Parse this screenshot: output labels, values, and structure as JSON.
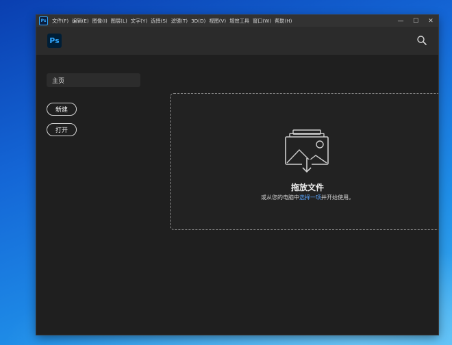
{
  "window": {
    "menu": [
      "文件(F)",
      "编辑(E)",
      "图像(I)",
      "图层(L)",
      "文字(Y)",
      "选择(S)",
      "滤镜(T)",
      "3D(D)",
      "视图(V)",
      "增效工具",
      "窗口(W)",
      "帮助(H)"
    ],
    "app_icon_text": "Ps",
    "controls": {
      "minimize": "—",
      "maximize": "☐",
      "close": "✕"
    }
  },
  "header": {
    "logo_text": "Ps",
    "search_icon": "search-icon"
  },
  "sidebar": {
    "home_label": "主页",
    "new_label": "新建",
    "open_label": "打开"
  },
  "dropzone": {
    "title": "拖放文件",
    "subtitle_before": "或从您的电脑中",
    "subtitle_link": "选择一项",
    "subtitle_after": "并开始使用。",
    "icon": "image-stack-download-icon"
  },
  "colors": {
    "accent": "#31a8ff",
    "link": "#5ba6ff",
    "background": "#1f1f1f"
  }
}
